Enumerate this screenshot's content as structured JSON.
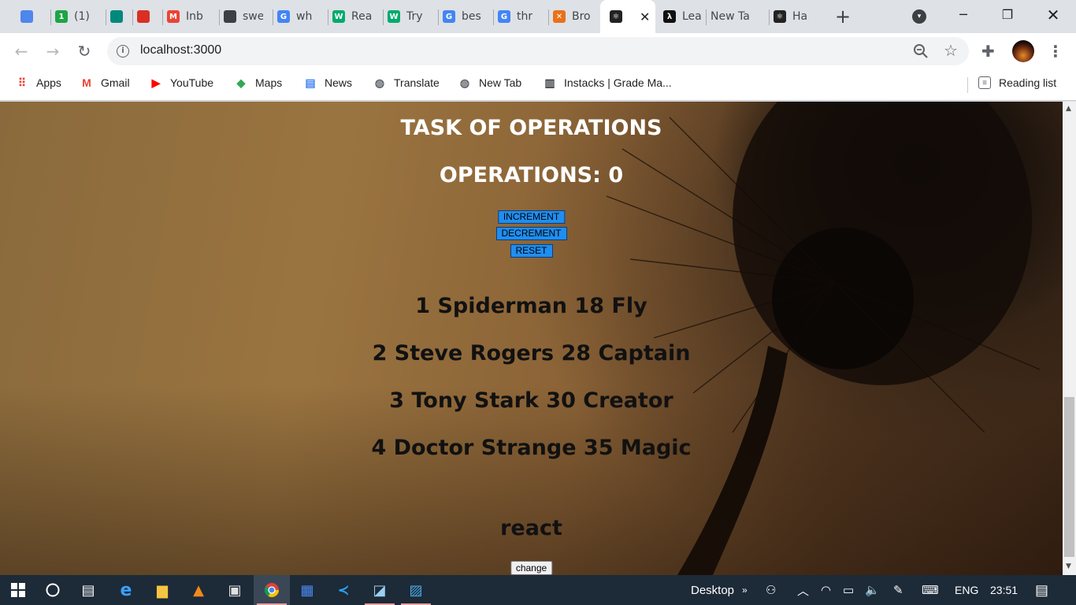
{
  "browser": {
    "tabs": [
      {
        "title": "",
        "icon": "multicolor-cube-icon",
        "color": "#4f86ec"
      },
      {
        "title": "(1)",
        "icon": "green-counter-icon",
        "color": "#1ea446",
        "badge": "1"
      },
      {
        "title": "",
        "icon": "google-meet-icon",
        "color": "#00897b"
      },
      {
        "title": "",
        "icon": "red-record-icon",
        "color": "#d93025"
      },
      {
        "title": "Inb",
        "icon": "gmail-icon",
        "color": "#ea4335",
        "glyph": "M"
      },
      {
        "title": "swe",
        "icon": "cube-icon",
        "color": "#3c4043"
      },
      {
        "title": "wh",
        "icon": "google-icon",
        "color": "#4285f4",
        "glyph": "G"
      },
      {
        "title": "Rea",
        "icon": "w3schools-icon",
        "color": "#04aa6d",
        "glyph": "W"
      },
      {
        "title": "Try",
        "icon": "w3schools-icon",
        "color": "#04aa6d",
        "glyph": "W"
      },
      {
        "title": "bes",
        "icon": "google-icon",
        "color": "#4285f4",
        "glyph": "G"
      },
      {
        "title": "thr",
        "icon": "google-icon",
        "color": "#4285f4",
        "glyph": "G"
      },
      {
        "title": "Bro",
        "icon": "brackets-icon",
        "color": "#e8711a",
        "glyph": "✕"
      },
      {
        "title": "",
        "icon": "react-icon",
        "color": "#222",
        "glyph": "⚛",
        "active": true
      },
      {
        "title": "Lea",
        "icon": "codewars-icon",
        "color": "#111",
        "glyph": "λ"
      },
      {
        "title": "New Ta",
        "icon": "",
        "color": ""
      },
      {
        "title": "Ha",
        "icon": "react-icon",
        "color": "#222",
        "glyph": "⚛"
      }
    ],
    "new_tab_glyph": "+",
    "url": "localhost:3000",
    "bookmarks": [
      {
        "label": "Apps",
        "icon": "apps-grid-icon",
        "color": "#ea4335",
        "glyph": "⠿"
      },
      {
        "label": "Gmail",
        "icon": "gmail-icon",
        "color": "#ea4335",
        "glyph": "M"
      },
      {
        "label": "YouTube",
        "icon": "youtube-icon",
        "color": "#ff0000",
        "glyph": "▶"
      },
      {
        "label": "Maps",
        "icon": "maps-icon",
        "color": "#34a853",
        "glyph": "◆"
      },
      {
        "label": "News",
        "icon": "news-icon",
        "color": "#4285f4",
        "glyph": "▤"
      },
      {
        "label": "Translate",
        "icon": "globe-icon",
        "color": "#5f6368",
        "glyph": "◍"
      },
      {
        "label": "New Tab",
        "icon": "globe-icon",
        "color": "#5f6368",
        "glyph": "◍"
      },
      {
        "label": "Instacks | Grade Ma...",
        "icon": "document-icon",
        "color": "#3c4043",
        "glyph": "▥"
      }
    ],
    "reading_list": "Reading list"
  },
  "page": {
    "title": "TASK OF OPERATIONS",
    "operations_label": "OPERATIONS: 0",
    "buttons": {
      "increment": "INCREMENT",
      "decrement": "DECREMENT",
      "reset": "RESET"
    },
    "heroes": [
      "1 Spiderman 18 Fly",
      "2 Steve Rogers 28 Captain",
      "3 Tony Stark 30 Creator",
      "4 Doctor Strange 35 Magic"
    ],
    "word": "react",
    "change_label": "change"
  },
  "taskbar": {
    "desktop_label": "Desktop",
    "language": "ENG",
    "time": "23:51"
  }
}
